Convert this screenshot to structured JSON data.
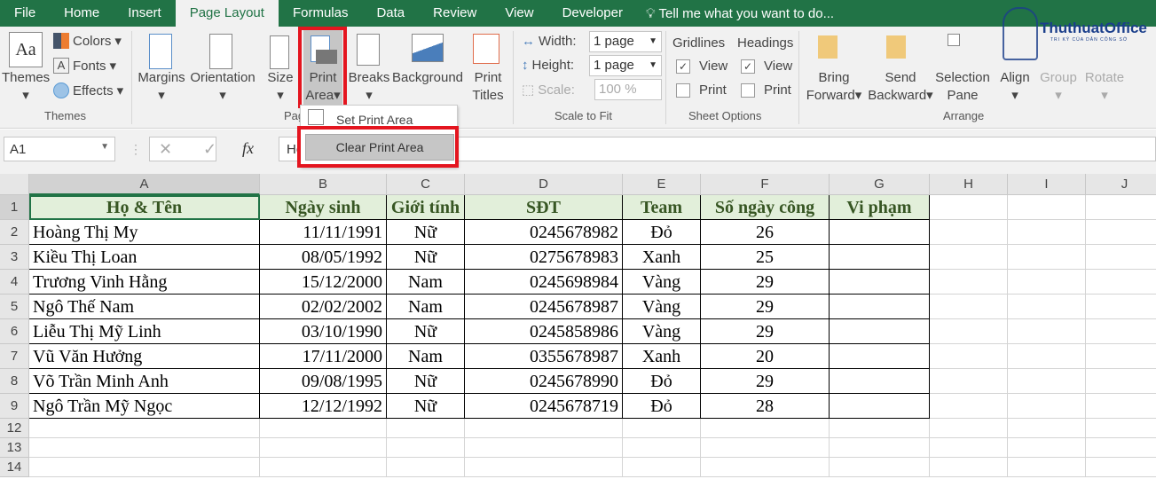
{
  "tabs": [
    "File",
    "Home",
    "Insert",
    "Page Layout",
    "Formulas",
    "Data",
    "Review",
    "View",
    "Developer"
  ],
  "tell_me": "Tell me what you want to do...",
  "ribbon": {
    "themes": "Themes",
    "colors": "Colors",
    "fonts": "Fonts",
    "effects": "Effects",
    "themes_group": "Themes",
    "margins": "Margins",
    "orientation": "Orientation",
    "size": "Size",
    "print": "Print",
    "area": "Area",
    "breaks": "Breaks",
    "background": "Background",
    "print2": "Print",
    "titles": "Titles",
    "page_setup_group": "Pag",
    "width_label": "Width:",
    "width_value": "1 page",
    "height_label": "Height:",
    "height_value": "1 page",
    "scale_label": "Scale:",
    "scale_value": "100 %",
    "scale_group": "Scale to Fit",
    "gridlines": "Gridlines",
    "headings": "Headings",
    "view": "View",
    "print_cb": "Print",
    "sheet_options_group": "Sheet Options",
    "bring": "Bring",
    "forward": "Forward",
    "send": "Send",
    "backward": "Backward",
    "selection": "Selection",
    "pane": "Pane",
    "align": "Align",
    "group": "Group",
    "rotate": "Rotate",
    "arrange_group": "Arrange"
  },
  "logo": {
    "name": "ThuthuatOffice",
    "tagline": "TRI KỶ CỦA DÂN CÔNG SỞ"
  },
  "menu": {
    "set": "Set Print Area",
    "clear": "Clear Print Area"
  },
  "formula": {
    "name_box": "A1",
    "content": "Họ"
  },
  "columns": [
    "A",
    "B",
    "C",
    "D",
    "E",
    "F",
    "G",
    "H",
    "I",
    "J"
  ],
  "row_numbers": [
    "1",
    "2",
    "3",
    "4",
    "5",
    "6",
    "7",
    "8",
    "9",
    "12",
    "13",
    "14"
  ],
  "headers": [
    "Họ & Tên",
    "Ngày sinh",
    "Giới tính",
    "SĐT",
    "Team",
    "Số ngày công",
    "Vi phạm"
  ],
  "rows": [
    [
      "Hoàng Thị My",
      "11/11/1991",
      "Nữ",
      "0245678982",
      "Đỏ",
      "26",
      ""
    ],
    [
      "Kiều Thị Loan",
      "08/05/1992",
      "Nữ",
      "0275678983",
      "Xanh",
      "25",
      ""
    ],
    [
      "Trương Vinh Hằng",
      "15/12/2000",
      "Nam",
      "0245698984",
      "Vàng",
      "29",
      ""
    ],
    [
      "Ngô Thế Nam",
      "02/02/2002",
      "Nam",
      "0245678987",
      "Vàng",
      "29",
      ""
    ],
    [
      "Liễu Thị Mỹ Linh",
      "03/10/1990",
      "Nữ",
      "0245858986",
      "Vàng",
      "29",
      ""
    ],
    [
      "Vũ Văn Hưởng",
      "17/11/2000",
      "Nam",
      "0355678987",
      "Xanh",
      "20",
      ""
    ],
    [
      "Võ Trần Minh Anh",
      "09/08/1995",
      "Nữ",
      "0245678990",
      "Đỏ",
      "29",
      ""
    ],
    [
      "Ngô Trần Mỹ Ngọc",
      "12/12/1992",
      "Nữ",
      "0245678719",
      "Đỏ",
      "28",
      ""
    ]
  ]
}
